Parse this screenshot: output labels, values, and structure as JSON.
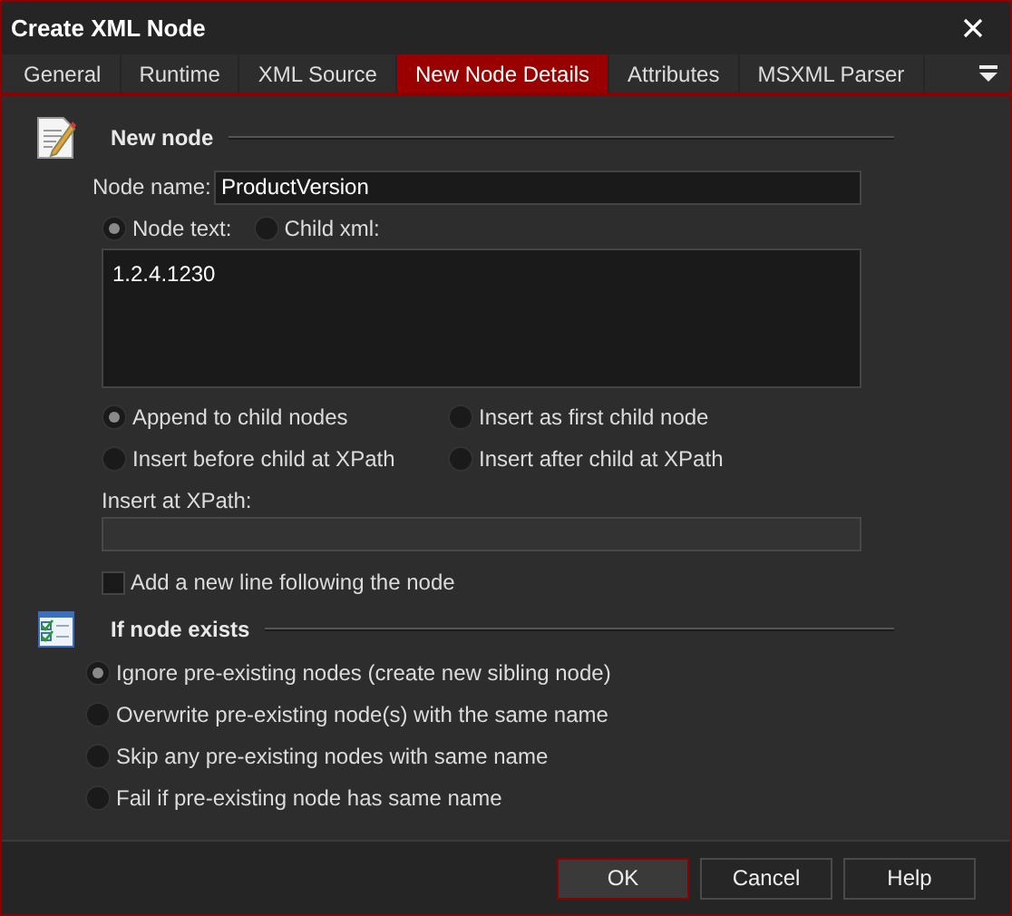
{
  "window": {
    "title": "Create XML Node"
  },
  "tabs": [
    {
      "label": "General",
      "selected": false
    },
    {
      "label": "Runtime",
      "selected": false
    },
    {
      "label": "XML Source",
      "selected": false
    },
    {
      "label": "New Node Details",
      "selected": true
    },
    {
      "label": "Attributes",
      "selected": false
    },
    {
      "label": "MSXML Parser",
      "selected": false
    }
  ],
  "new_node": {
    "title": "New node",
    "node_name_label": "Node name:",
    "node_name": "ProductVersion",
    "content_type": [
      {
        "label": "Node text:",
        "selected": true
      },
      {
        "label": "Child xml:",
        "selected": false
      }
    ],
    "node_text": "1.2.4.1230",
    "position": [
      {
        "label": "Append to child nodes",
        "selected": true
      },
      {
        "label": "Insert as first child node",
        "selected": false
      },
      {
        "label": "Insert before child at XPath",
        "selected": false
      },
      {
        "label": "Insert after child at XPath",
        "selected": false
      }
    ],
    "xpath_label": "Insert at XPath:",
    "add_new_line": {
      "label": "Add a new line following the node",
      "checked": false
    }
  },
  "if_node_exists": {
    "title": "If node exists",
    "options": [
      {
        "label": "Ignore pre-existing nodes (create new sibling node)",
        "selected": true
      },
      {
        "label": "Overwrite pre-existing node(s) with the same name",
        "selected": false
      },
      {
        "label": "Skip any pre-existing nodes with same name",
        "selected": false
      },
      {
        "label": "Fail if pre-existing node has same name",
        "selected": false
      }
    ]
  },
  "buttons": [
    {
      "label": "OK",
      "default": true
    },
    {
      "label": "Cancel",
      "default": false
    },
    {
      "label": "Help",
      "default": false
    }
  ]
}
